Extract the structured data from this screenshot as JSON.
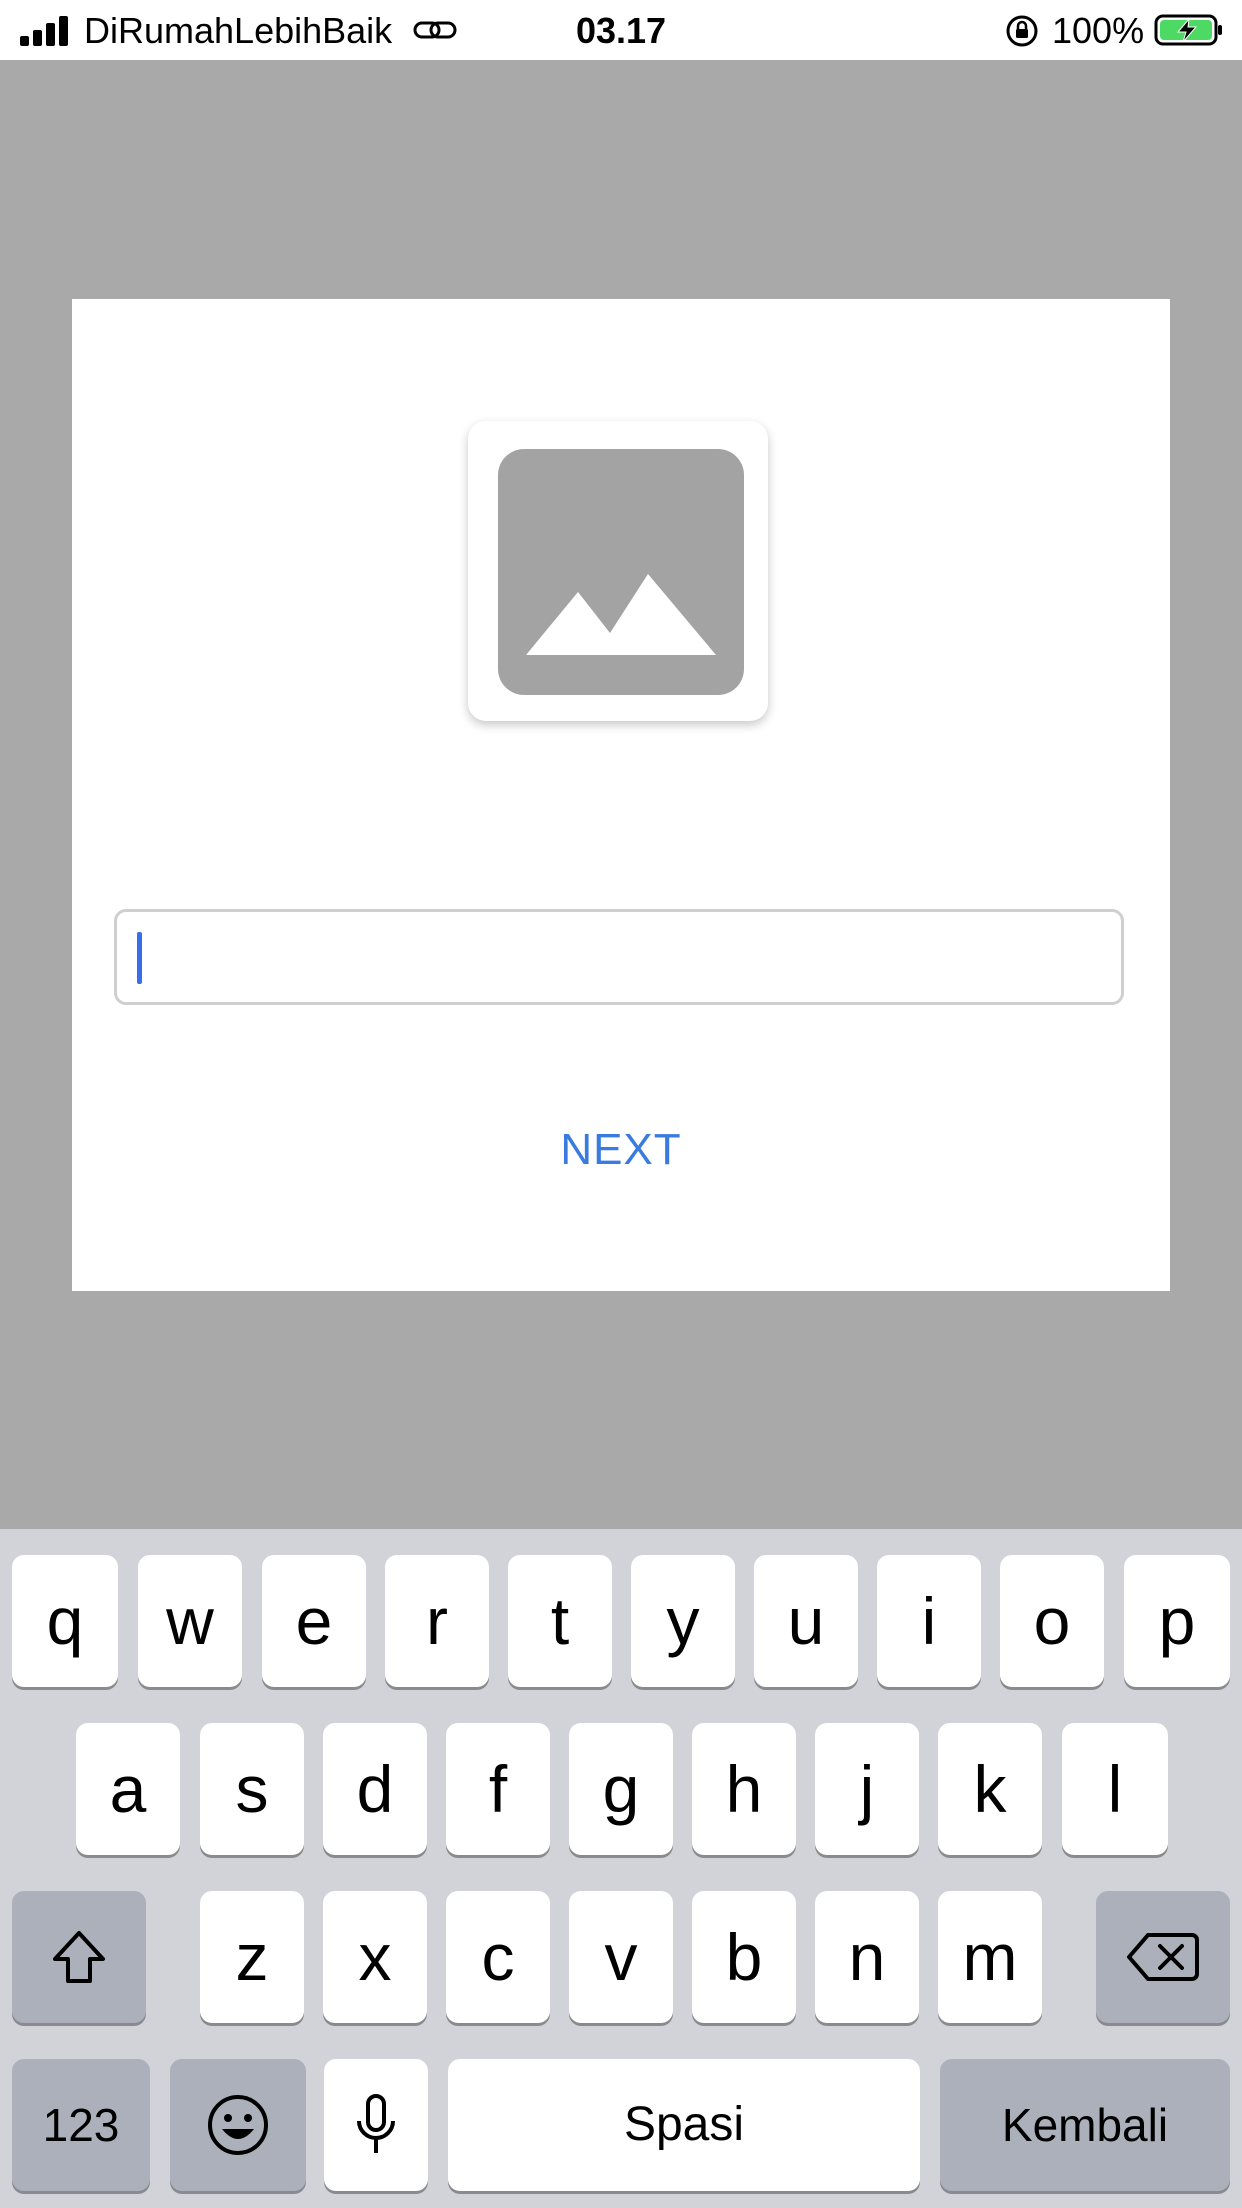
{
  "status_bar": {
    "carrier": "DiRumahLebihBaik",
    "time": "03.17",
    "battery": "100%",
    "icons": [
      "signal-icon",
      "link-icon",
      "orientation-lock-icon",
      "battery-charging-icon"
    ]
  },
  "dialog": {
    "image_icon": "image-placeholder-icon",
    "input_value": "",
    "next_label": "NEXT",
    "next_color": "#3a7be0"
  },
  "keyboard": {
    "row1": [
      "q",
      "w",
      "e",
      "r",
      "t",
      "y",
      "u",
      "i",
      "o",
      "p"
    ],
    "row2": [
      "a",
      "s",
      "d",
      "f",
      "g",
      "h",
      "j",
      "k",
      "l"
    ],
    "row3": [
      "z",
      "x",
      "c",
      "v",
      "b",
      "n",
      "m"
    ],
    "numbers_label": "123",
    "space_label": "Spasi",
    "return_label": "Kembali",
    "icons": [
      "shift-icon",
      "backspace-icon",
      "emoji-icon",
      "microphone-icon"
    ]
  }
}
